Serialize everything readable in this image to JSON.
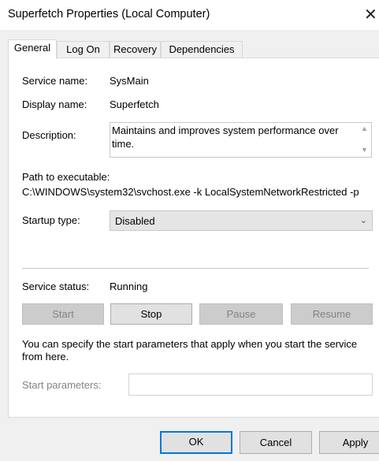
{
  "window": {
    "title": "Superfetch Properties (Local Computer)",
    "close_glyph": "✕"
  },
  "tabs": [
    {
      "label": "General",
      "active": true
    },
    {
      "label": "Log On",
      "active": false
    },
    {
      "label": "Recovery",
      "active": false
    },
    {
      "label": "Dependencies",
      "active": false
    }
  ],
  "general": {
    "service_name_label": "Service name:",
    "service_name": "SysMain",
    "display_name_label": "Display name:",
    "display_name": "Superfetch",
    "description_label": "Description:",
    "description": "Maintains and improves system performance over time.",
    "path_label": "Path to executable:",
    "path": "C:\\WINDOWS\\system32\\svchost.exe -k LocalSystemNetworkRestricted -p",
    "startup_type_label": "Startup type:",
    "startup_type": "Disabled",
    "status_label": "Service status:",
    "status": "Running",
    "start_button": "Start",
    "stop_button": "Stop",
    "pause_button": "Pause",
    "resume_button": "Resume",
    "hint": "You can specify the start parameters that apply when you start the service from here.",
    "start_params_label": "Start parameters:",
    "start_params_value": ""
  },
  "footer": {
    "ok": "OK",
    "cancel": "Cancel",
    "apply": "Apply"
  },
  "colors": {
    "accent": "#0078d7",
    "disabled_text": "#838383"
  },
  "icons": {
    "close": "close-icon",
    "dropdown": "chevron-down-icon",
    "scroll_up": "chevron-up-icon",
    "scroll_down": "chevron-down-icon"
  }
}
